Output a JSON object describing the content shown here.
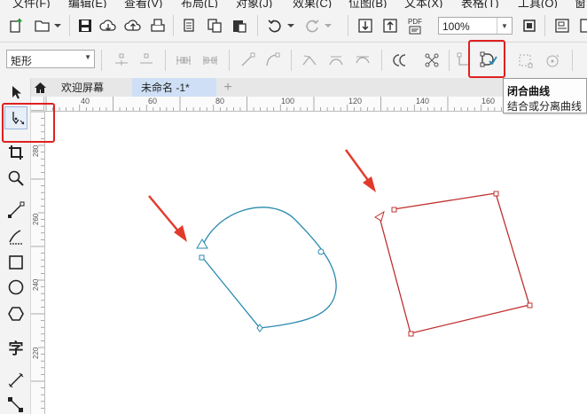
{
  "menu": {
    "items": [
      "文件(F)",
      "编辑(E)",
      "查看(V)",
      "布局(L)",
      "对象(J)",
      "效果(C)",
      "位图(B)",
      "文本(X)",
      "表格(T)",
      "工具(O)",
      "窗"
    ]
  },
  "toolbar": {
    "zoom_value": "100%",
    "pdf_label": "PDF"
  },
  "property_bar": {
    "shape_value": "矩形"
  },
  "tabs": {
    "welcome": "欢迎屏幕",
    "untitled": "未命名 -1*",
    "add": "+"
  },
  "ruler": {
    "h_labels": [
      "40",
      "60",
      "80",
      "100",
      "120",
      "140",
      "160"
    ],
    "v_labels": [
      "280",
      "260",
      "240",
      "220"
    ]
  },
  "tooltip": {
    "title": "闭合曲线",
    "description": "结合或分离曲线"
  },
  "toolbox": {
    "text_tool_glyph": "字"
  },
  "colors": {
    "highlight": "#e02020",
    "blue_curve": "#2a8ab0",
    "red_shape": "#c03030",
    "arrow": "#e23a2a"
  }
}
